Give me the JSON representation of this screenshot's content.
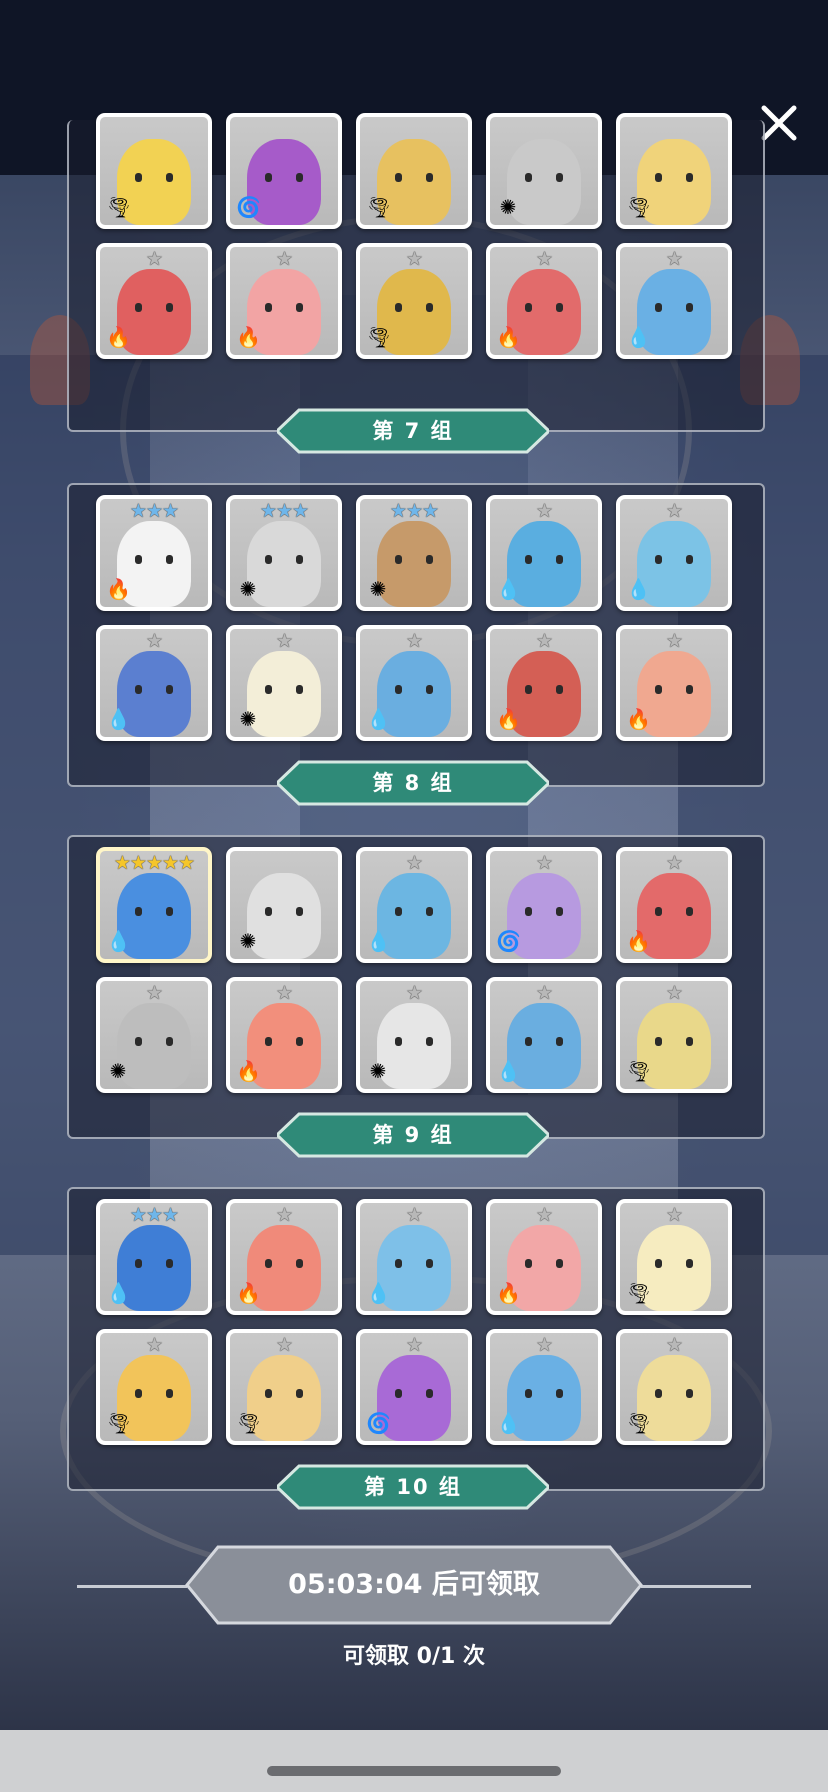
{
  "close": {
    "icon": "close-icon"
  },
  "groups": [
    {
      "label": "第 7 组",
      "partial": true,
      "rows": [
        [
          {
            "c": "#f2d253",
            "e": "wind",
            "s": 0
          },
          {
            "c": "#a65bc9",
            "e": "dark",
            "s": 0
          },
          {
            "c": "#e7c160",
            "e": "wind",
            "s": 0
          },
          {
            "c": "#c9c9c9",
            "e": "light",
            "s": 0
          },
          {
            "c": "#f0d37a",
            "e": "wind",
            "s": 0
          }
        ],
        [
          {
            "c": "#e06060",
            "e": "fire",
            "s": 1
          },
          {
            "c": "#f2a4a4",
            "e": "fire",
            "s": 1
          },
          {
            "c": "#e0b84c",
            "e": "wind",
            "s": 1
          },
          {
            "c": "#e26b6b",
            "e": "fire",
            "s": 1
          },
          {
            "c": "#6ab0e4",
            "e": "water",
            "s": 1
          }
        ]
      ]
    },
    {
      "label": "第 8 组",
      "rows": [
        [
          {
            "c": "#f3f3f3",
            "e": "fire",
            "s": 3,
            "sc": "blue"
          },
          {
            "c": "#d9d9d9",
            "e": "light",
            "s": 3,
            "sc": "blue"
          },
          {
            "c": "#c69a6a",
            "e": "light",
            "s": 3,
            "sc": "blue"
          },
          {
            "c": "#5aaee0",
            "e": "water",
            "s": 1
          },
          {
            "c": "#7cc3e6",
            "e": "water",
            "s": 1
          }
        ],
        [
          {
            "c": "#5b7fd0",
            "e": "water",
            "s": 1
          },
          {
            "c": "#f3eed8",
            "e": "light",
            "s": 1
          },
          {
            "c": "#6aaee0",
            "e": "water",
            "s": 1
          },
          {
            "c": "#d45f55",
            "e": "fire",
            "s": 1
          },
          {
            "c": "#f0a890",
            "e": "fire",
            "s": 1
          }
        ]
      ]
    },
    {
      "label": "第 9 组",
      "rows": [
        [
          {
            "c": "#4a8fe0",
            "e": "water",
            "s": 5,
            "sc": "gold",
            "gold": true
          },
          {
            "c": "#e0e0e0",
            "e": "light",
            "s": 0
          },
          {
            "c": "#6cb6e2",
            "e": "water",
            "s": 1
          },
          {
            "c": "#b79ae0",
            "e": "dark",
            "s": 1
          },
          {
            "c": "#e36a6a",
            "e": "fire",
            "s": 1
          }
        ],
        [
          {
            "c": "#bdbdbd",
            "e": "light",
            "s": 1
          },
          {
            "c": "#f28f7c",
            "e": "fire",
            "s": 1
          },
          {
            "c": "#e6e6e6",
            "e": "light",
            "s": 1
          },
          {
            "c": "#6aaee0",
            "e": "water",
            "s": 1
          },
          {
            "c": "#e9d88a",
            "e": "wind",
            "s": 1
          }
        ]
      ]
    },
    {
      "label": "第 10 组",
      "rows": [
        [
          {
            "c": "#3f7ed6",
            "e": "water",
            "s": 3,
            "sc": "blue"
          },
          {
            "c": "#f08a7a",
            "e": "fire",
            "s": 1
          },
          {
            "c": "#7ec0e8",
            "e": "water",
            "s": 1
          },
          {
            "c": "#f2a7a7",
            "e": "fire",
            "s": 1
          },
          {
            "c": "#f6ecc0",
            "e": "wind",
            "s": 1
          }
        ],
        [
          {
            "c": "#f2c45a",
            "e": "wind",
            "s": 1
          },
          {
            "c": "#f0cf8a",
            "e": "wind",
            "s": 1
          },
          {
            "c": "#a86ad6",
            "e": "dark",
            "s": 1
          },
          {
            "c": "#6ab0e4",
            "e": "water",
            "s": 1
          },
          {
            "c": "#eedc9a",
            "e": "wind",
            "s": 1
          }
        ]
      ]
    }
  ],
  "claim": {
    "button_label": "05:03:04 后可领取",
    "count_label": "可领取 0/1 次"
  },
  "element_icons": {
    "fire": "🔥",
    "water": "💧",
    "light": "✺",
    "wind": "🌪",
    "dark": "🌀"
  },
  "colors": {
    "banner": "#2f8a78",
    "banner_border": "#d6e8e2",
    "claim_button": "#8a8f99",
    "accent_blue_star": "#6fb6ea",
    "accent_gold_star": "#f5c62a"
  }
}
